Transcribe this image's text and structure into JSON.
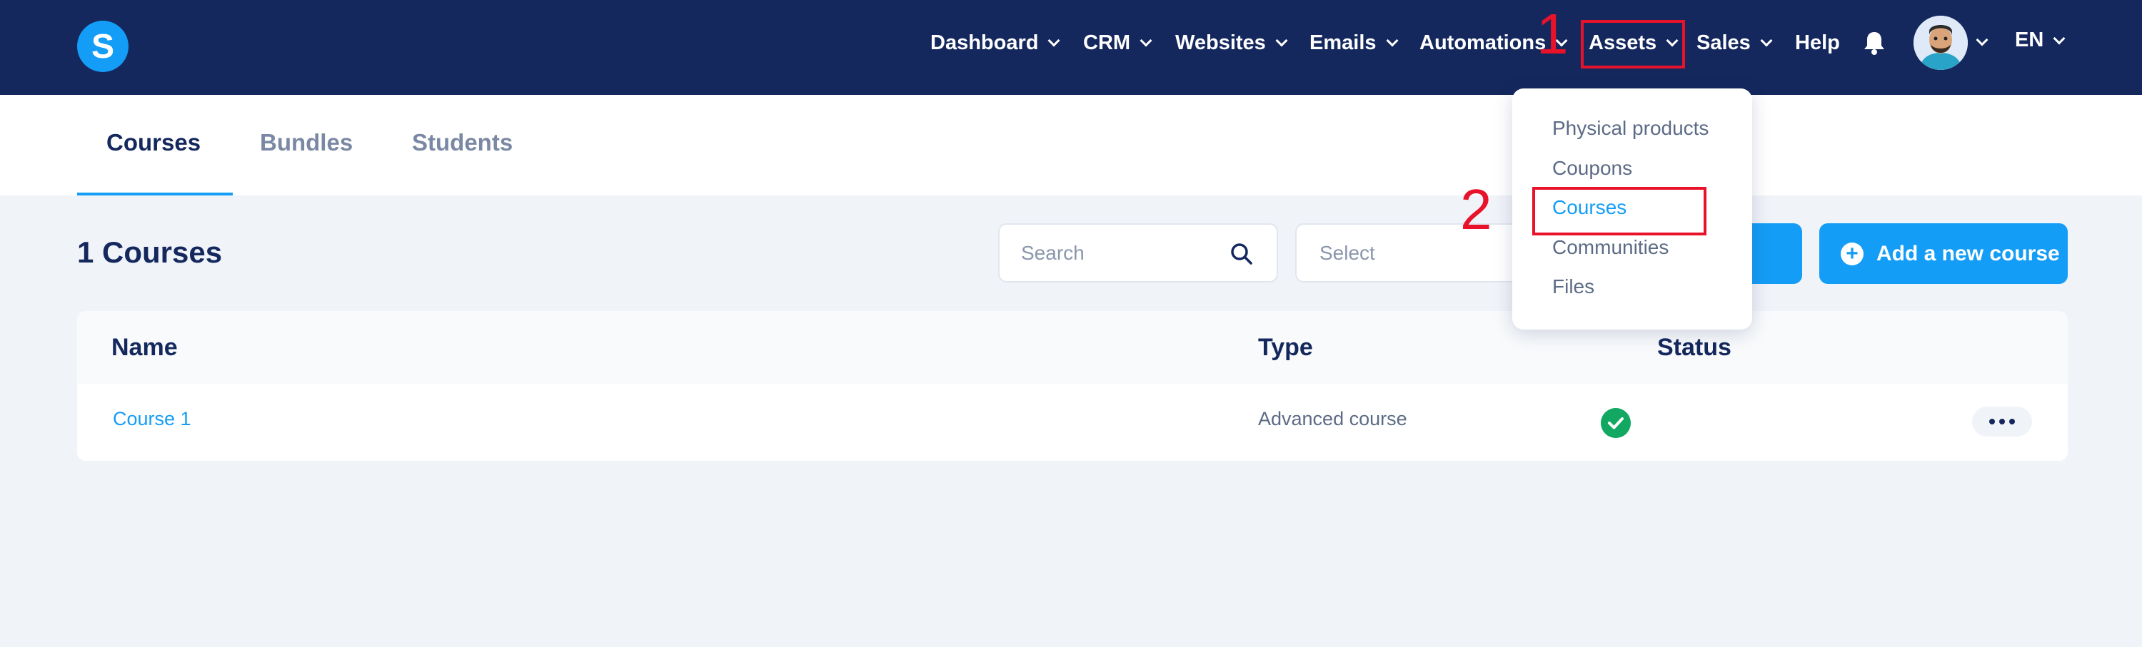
{
  "nav": {
    "logo": "S",
    "items": [
      {
        "label": "Dashboard"
      },
      {
        "label": "CRM"
      },
      {
        "label": "Websites"
      },
      {
        "label": "Emails"
      },
      {
        "label": "Automations"
      },
      {
        "label": "Assets"
      },
      {
        "label": "Sales"
      },
      {
        "label": "Help"
      }
    ],
    "language": "EN"
  },
  "annotations": {
    "step1": "1",
    "step2": "2",
    "color": "#e8132a"
  },
  "assets_menu": {
    "items": [
      {
        "label": "Physical products"
      },
      {
        "label": "Coupons"
      },
      {
        "label": "Courses"
      },
      {
        "label": "Communities"
      },
      {
        "label": "Files"
      }
    ],
    "active": "Courses"
  },
  "tabs": [
    {
      "label": "Courses"
    },
    {
      "label": "Bundles"
    },
    {
      "label": "Students"
    }
  ],
  "page": {
    "title": "1 Courses",
    "search_placeholder": "Search",
    "select_placeholder": "Select",
    "add_button": "Add a new course"
  },
  "table": {
    "headers": {
      "name": "Name",
      "type": "Type",
      "status": "Status"
    },
    "rows": [
      {
        "name": "Course 1",
        "type": "Advanced course",
        "status": "active"
      }
    ]
  },
  "colors": {
    "navbar": "#14285e",
    "accent": "#149df6",
    "status_active": "#12a862"
  },
  "icons": [
    "logo-icon",
    "bell-icon",
    "search-icon",
    "plus-circle-icon",
    "check-circle-icon",
    "more-icon",
    "chevron-down-icon"
  ]
}
